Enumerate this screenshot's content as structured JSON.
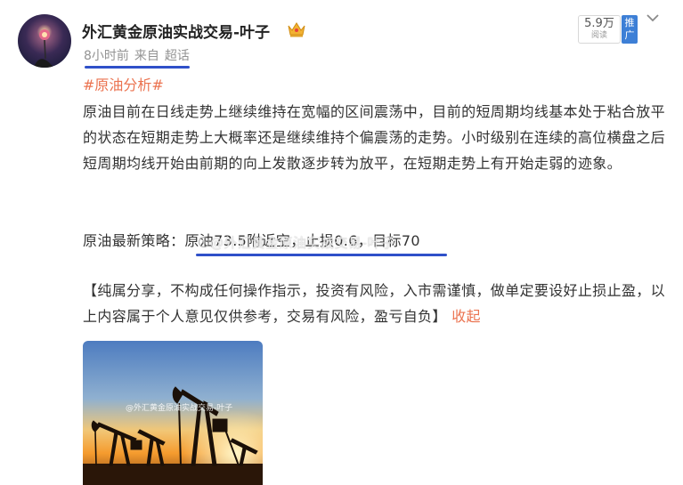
{
  "post": {
    "author_name": "外汇黄金原油实战交易-叶子",
    "badge_icon": "crown-icon",
    "time": "8小时前",
    "source_prefix": "来自",
    "source": "超话",
    "reads_count": "5.9万",
    "reads_label": "阅读",
    "promo_label": "推广",
    "topic": "#原油分析#",
    "paragraph_1": "原油目前在日线走势上继续维持在宽幅的区间震荡中，目前的短周期均线基本处于粘合放平的状态在短期走势上大概率还是继续维持个偏震荡的走势。小时级别在连续的高位横盘之后短周期均线开始由前期的向上发散逐步转为放平，在短期走势上有开始走弱的迹象。",
    "strategy_text": "原油最新策略：原油73.5附近空，止损0.6，目标70",
    "watermark": "@外汇黄金原油实战交易-叶子",
    "disclaimer": "【纯属分享，不构成任何操作指示，投资有风险，入市需谨慎，做单定要设好止损止盈，以上内容属于个人意见仅供参考，交易有风险，盈亏自负】",
    "collapse_label": "收起",
    "image_watermark": "@外汇黄金原油实战交易-叶子"
  },
  "colors": {
    "accent_link": "#eb7350",
    "underline_annotation": "#2f50c9",
    "promo_bg": "#3d7fd6"
  }
}
